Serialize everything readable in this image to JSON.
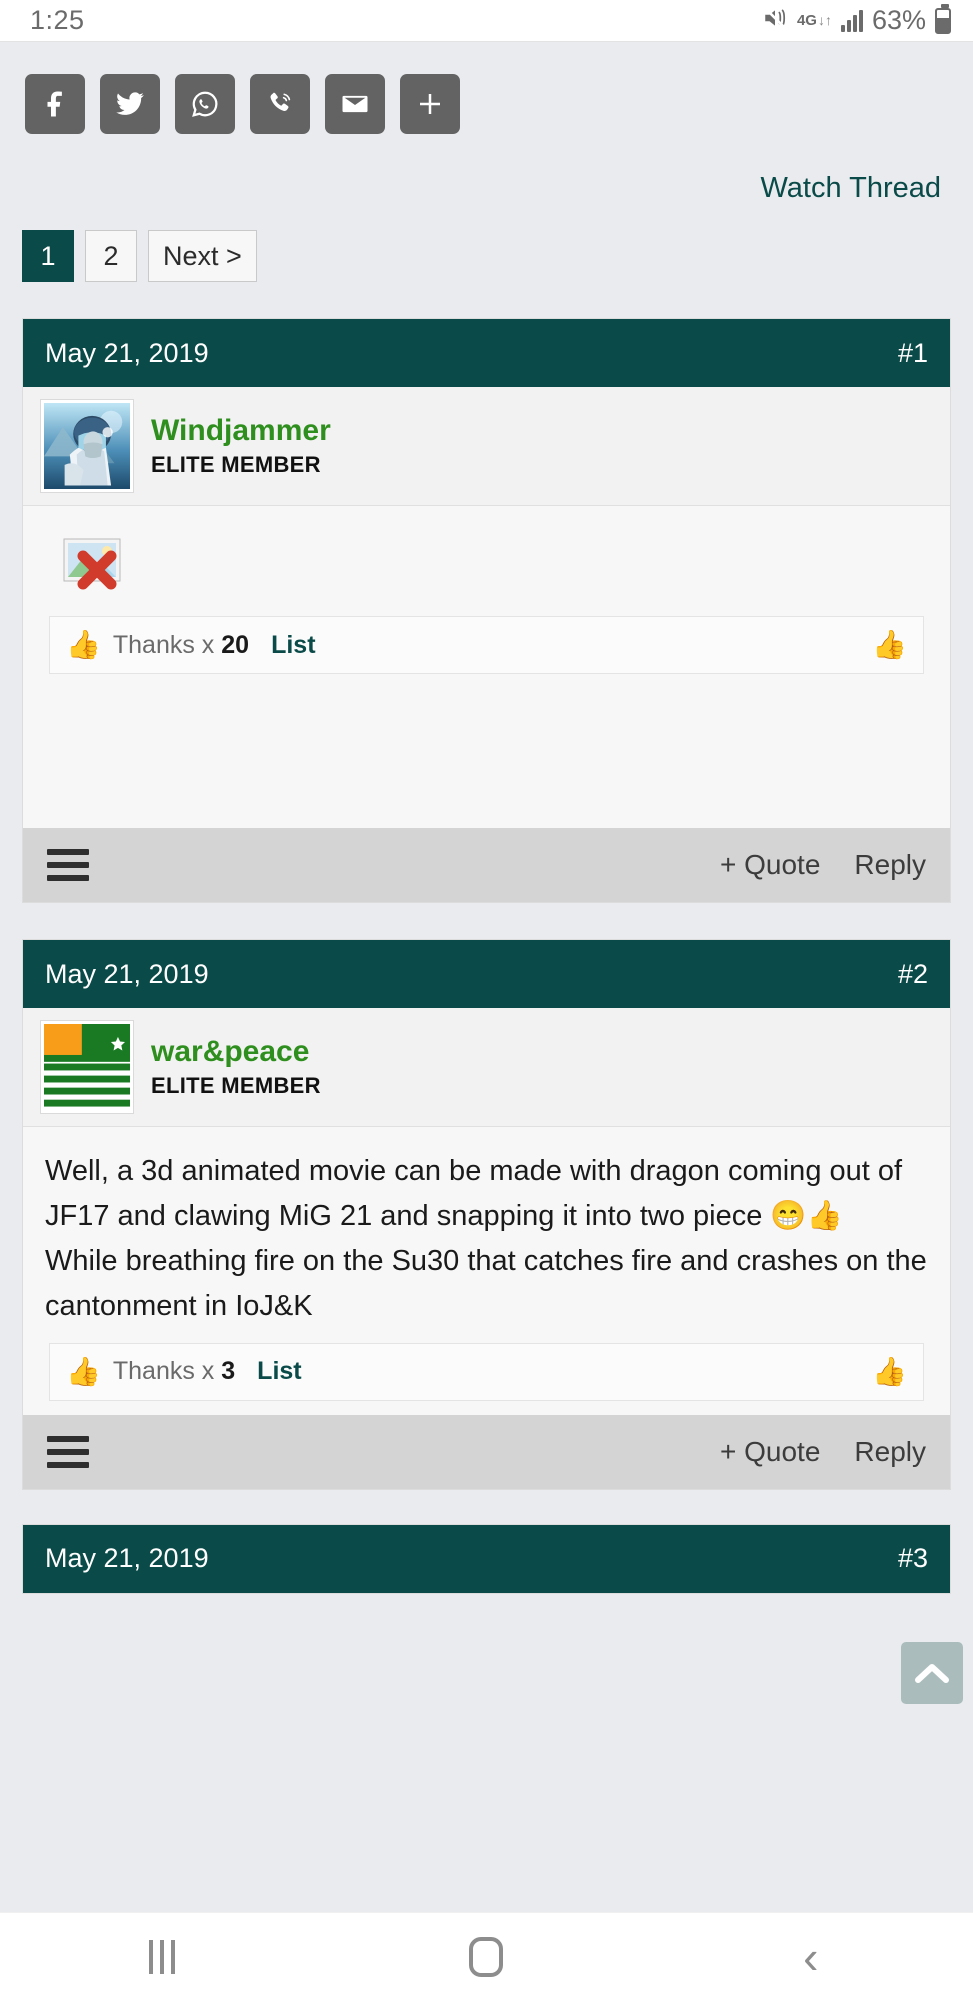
{
  "statusbar": {
    "time": "1:25",
    "network_label": "4G",
    "network_arrows": "↓↑",
    "battery_percent": "63%",
    "mute_icon": "mute-icon",
    "signal_icon": "signal-bars-icon",
    "battery_icon": "battery-icon"
  },
  "share": {
    "buttons": [
      {
        "name": "facebook",
        "label": "Facebook"
      },
      {
        "name": "twitter",
        "label": "Twitter"
      },
      {
        "name": "whatsapp",
        "label": "WhatsApp"
      },
      {
        "name": "viber",
        "label": "Viber"
      },
      {
        "name": "email",
        "label": "Email"
      },
      {
        "name": "more",
        "label": "+"
      }
    ]
  },
  "watch_thread": {
    "label": "Watch Thread"
  },
  "pagination": {
    "pages": [
      {
        "label": "1",
        "active": true
      },
      {
        "label": "2",
        "active": false
      },
      {
        "label": "Next >",
        "active": false
      }
    ]
  },
  "posts": [
    {
      "date": "May 21, 2019",
      "number": "#1",
      "username": "Windjammer",
      "usertitle": "ELITE MEMBER",
      "avatar_icon": "pilot-avatar",
      "body_type": "broken-image",
      "body_text": "",
      "thanks_prefix": "Thanks x",
      "thanks_count": "20",
      "thanks_list_label": "List",
      "quote_label": "+ Quote",
      "reply_label": "Reply"
    },
    {
      "date": "May 21, 2019",
      "number": "#2",
      "username": "war&peace",
      "usertitle": "ELITE MEMBER",
      "avatar_icon": "azad-kashmir-flag",
      "body_type": "text",
      "body_text": "Well, a 3d animated movie can be made with dragon coming out of JF17 and clawing MiG 21 and snapping it into two piece 😁👍\nWhile breathing fire on the Su30 that catches fire and crashes on the cantonment in IoJ&K",
      "thanks_prefix": "Thanks x",
      "thanks_count": "3",
      "thanks_list_label": "List",
      "quote_label": "+ Quote",
      "reply_label": "Reply"
    }
  ],
  "partial_post": {
    "date": "May 21, 2019",
    "number": "#3"
  },
  "scroll_top": {
    "icon": "chevron-up-icon"
  },
  "navbar": {
    "recents": "recents-icon",
    "home": "home-icon",
    "back": "‹"
  },
  "colors": {
    "accent_teal": "#0a4a48",
    "username_green": "#2f8f1e",
    "page_bg": "#e9ebee",
    "share_btn": "#636363",
    "footer_bg": "#d4d4d4"
  }
}
